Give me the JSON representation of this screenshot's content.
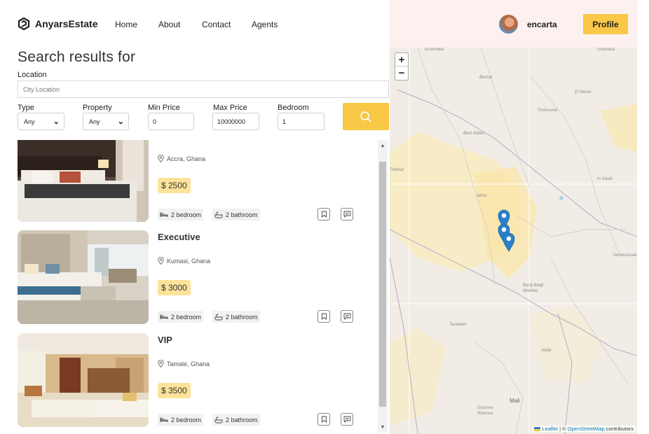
{
  "header": {
    "logo_text": "AnyarsEstate",
    "nav": [
      "Home",
      "About",
      "Contact",
      "Agents"
    ],
    "user_name": "encarta",
    "profile_label": "Profile"
  },
  "search": {
    "title": "Search results for",
    "location_label": "Location",
    "location_placeholder": "City Location",
    "type_label": "Type",
    "type_value": "Any",
    "property_label": "Property",
    "property_value": "Any",
    "min_price_label": "Min Price",
    "min_price_value": "0",
    "max_price_label": "Max Price",
    "max_price_value": "10000000",
    "bedroom_label": "Bedroom",
    "bedroom_value": "1"
  },
  "listings": [
    {
      "title": "",
      "location": "Accra, Ghana",
      "price": "$ 2500",
      "bedrooms": "2 bedroom",
      "bathrooms": "2 bathroom"
    },
    {
      "title": "Executive",
      "location": "Kumasi, Ghana",
      "price": "$ 3000",
      "bedrooms": "2 bedroom",
      "bathrooms": "2 bathroom"
    },
    {
      "title": "VIP",
      "location": "Tamale, Ghana",
      "price": "$ 3500",
      "bedrooms": "2 bedroom",
      "bathrooms": "2 bathroom"
    }
  ],
  "map": {
    "zoom_in": "+",
    "zoom_out": "−",
    "places": [
      "Errachidia",
      "Béchar",
      "Beni Abbès",
      "Timimoune",
      "Tindouf",
      "Adrar",
      "In Salah",
      "Bordj Badji Mokhtar",
      "Taoudeni",
      "Tamanrasset",
      "Kidal",
      "Mali",
      "Gourma-Rharous",
      "Ghardaïa",
      "El Menia"
    ],
    "attribution_leaflet": "Leaflet",
    "attribution_sep": " | © ",
    "attribution_osm": "OpenStreetMap",
    "attribution_tail": " contributors"
  },
  "colors": {
    "accent": "#f8c846",
    "price_bg": "#fde39a",
    "header_right_bg": "#fcf1ee",
    "pin": "#2a81cb"
  }
}
